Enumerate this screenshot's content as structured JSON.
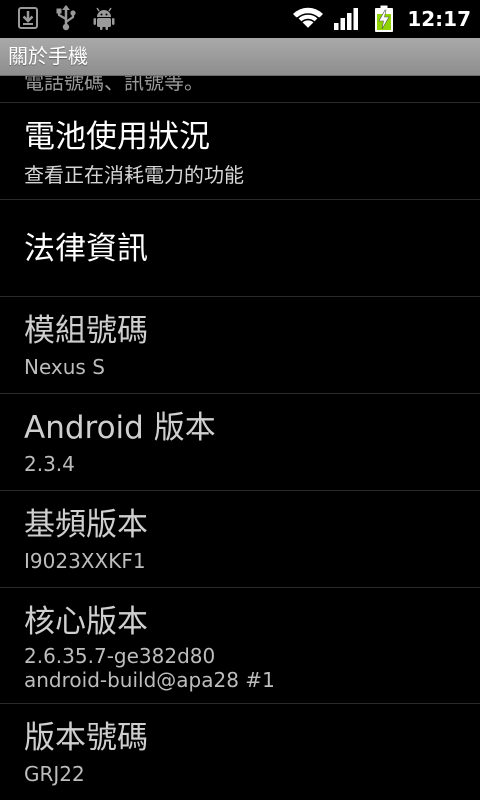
{
  "status_bar": {
    "time": "12:17",
    "icons": [
      "download-icon",
      "usb-icon",
      "android-debug-icon",
      "wifi-icon",
      "signal-icon",
      "battery-charging-icon"
    ]
  },
  "title_bar": {
    "title": "關於手機"
  },
  "list": {
    "partial_item_text": "電話號碼、訊號等。",
    "items": [
      {
        "title": "電池使用狀況",
        "summary": "查看正在消耗電力的功能"
      },
      {
        "title": "法律資訊"
      },
      {
        "title": "模組號碼",
        "summary": "Nexus S"
      },
      {
        "title": "Android 版本",
        "summary": "2.3.4"
      },
      {
        "title": "基頻版本",
        "summary": "I9023XXKF1"
      },
      {
        "title": "核心版本",
        "summary_line1": "2.6.35.7-ge382d80",
        "summary_line2": "android-build@apa28 #1"
      },
      {
        "title": "版本號碼",
        "summary": "GRJ22"
      }
    ]
  },
  "colors": {
    "background": "#000000",
    "title_bar": "#9b9b9b",
    "divider": "#2b2b2b",
    "battery_green": "#8fd400"
  }
}
